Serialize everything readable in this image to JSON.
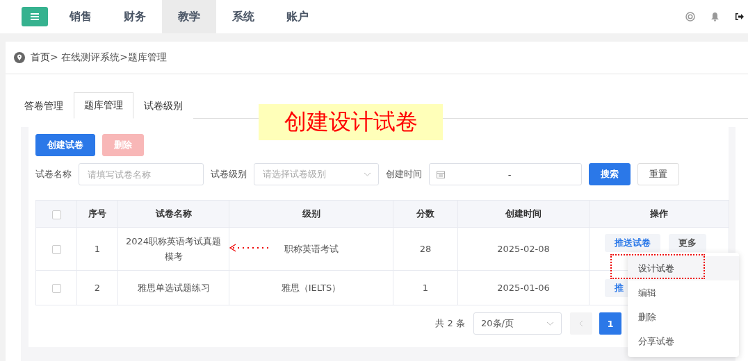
{
  "nav": {
    "items": [
      {
        "label": "销售",
        "selected": false
      },
      {
        "label": "财务",
        "selected": false
      },
      {
        "label": "教学",
        "selected": true
      },
      {
        "label": "系统",
        "selected": false
      },
      {
        "label": "账户",
        "selected": false
      }
    ]
  },
  "breadcrumb": {
    "home": "首页",
    "path": "> 在线测评系统>题库管理"
  },
  "tabs": [
    {
      "label": "答卷管理",
      "selected": false
    },
    {
      "label": "题库管理",
      "selected": true
    },
    {
      "label": "试卷级别",
      "selected": false
    }
  ],
  "annotation": "创建设计试卷",
  "toolbar": [
    {
      "label": "创建试卷",
      "disabled": false
    },
    {
      "label": "删除",
      "disabled": true
    }
  ],
  "filters": {
    "name_label": "试卷名称",
    "name_placeholder": "请填写试卷名称",
    "level_label": "试卷级别",
    "level_placeholder": "请选择试卷级别",
    "time_label": "创建时间",
    "range_separator": "-",
    "search": "搜索",
    "reset": "重置"
  },
  "table": {
    "all_checked": false,
    "columns": [
      "序号",
      "试卷名称",
      "级别",
      "分数",
      "创建时间",
      "操作"
    ],
    "rows": [
      {
        "checked": false,
        "no": "1",
        "name": "2024职称英语考试真题模考",
        "level": "职称英语考试",
        "score": "28",
        "created": "2025-02-08",
        "actions": [
          "推送试卷",
          "更多"
        ]
      },
      {
        "checked": false,
        "no": "2",
        "name": "雅思单选试题练习",
        "level": "雅思（IELTS）",
        "score": "1",
        "created": "2025-01-06",
        "actions": [
          "推"
        ]
      }
    ]
  },
  "pagination": {
    "total": "共 2 条",
    "page_size": "20条/页",
    "pages": [
      {
        "label": "1",
        "selected": true
      }
    ]
  },
  "menu": [
    {
      "label": "设计试卷",
      "selected": true
    },
    {
      "label": "编辑",
      "selected": false
    },
    {
      "label": "删除",
      "selected": false
    },
    {
      "label": "分享试卷",
      "selected": false
    }
  ]
}
